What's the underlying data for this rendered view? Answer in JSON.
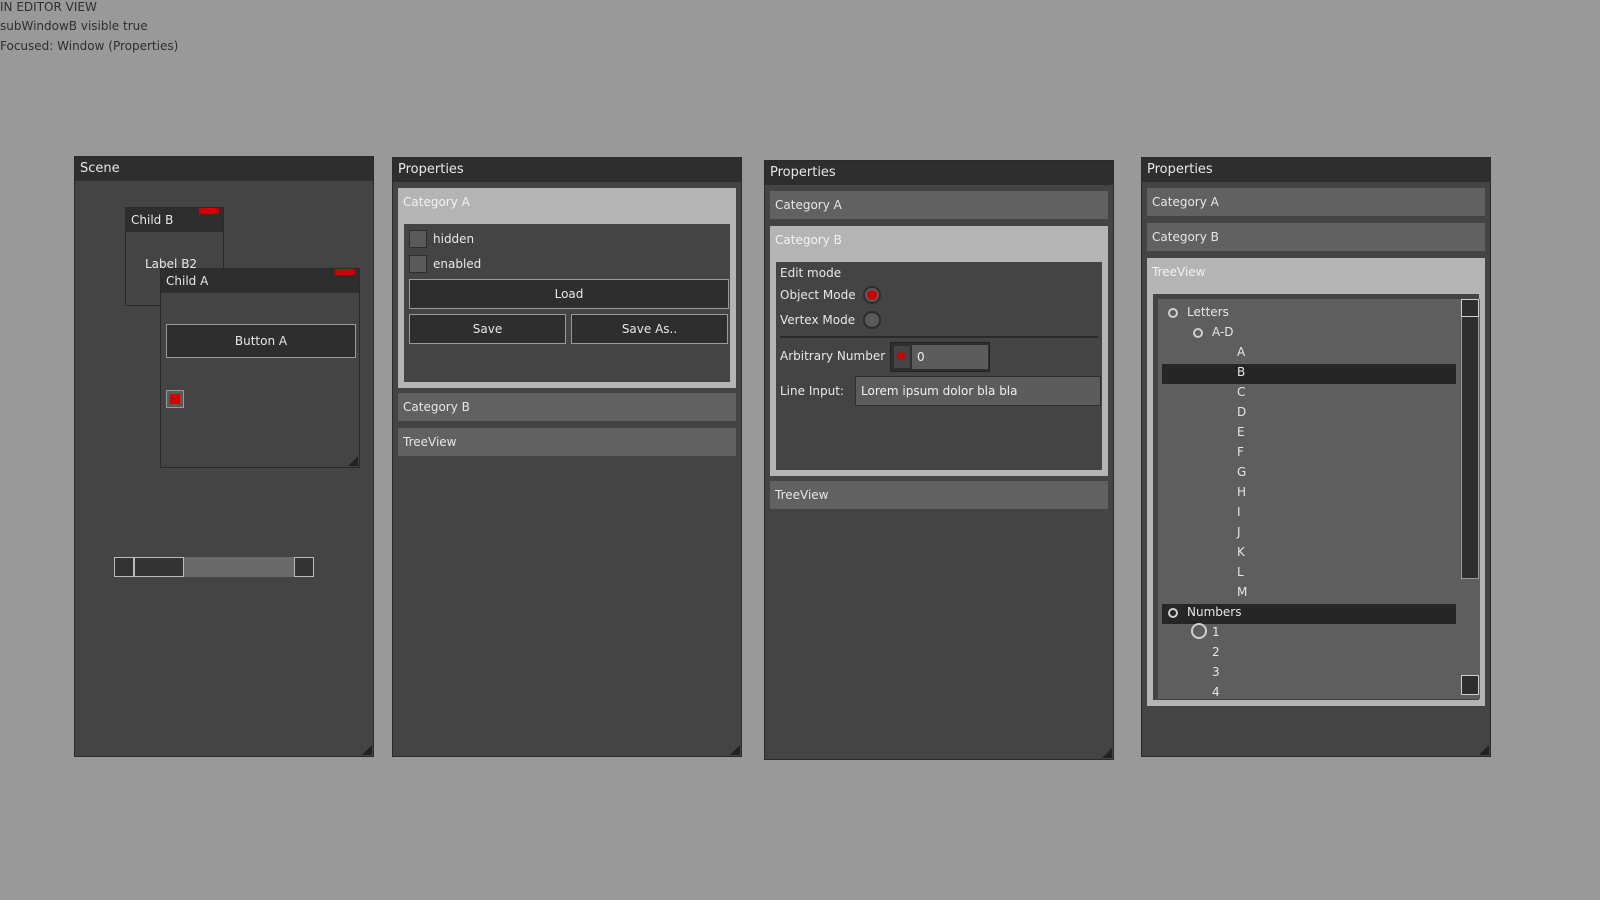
{
  "status": {
    "line1": "IN EDITOR VIEW",
    "line2": "subWindowB visible true",
    "line3": "Focused: Window (Properties)"
  },
  "scene": {
    "title": "Scene",
    "child_b": {
      "title": "Child B",
      "label": "Label B2"
    },
    "child_a": {
      "title": "Child A",
      "button": "Button A"
    },
    "scrollbar": {
      "value": 0.25
    }
  },
  "props1": {
    "title": "Properties",
    "category_a": "Category A",
    "hidden": "hidden",
    "enabled": "enabled",
    "load": "Load",
    "save": "Save",
    "save_as": "Save As..",
    "category_b": "Category B",
    "treeview": "TreeView"
  },
  "props2": {
    "title": "Properties",
    "category_a": "Category A",
    "category_b": "Category B",
    "edit_mode": "Edit mode",
    "object_mode": "Object Mode",
    "vertex_mode": "Vertex Mode",
    "arbitrary_number": "Arbitrary Number",
    "number_value": "0",
    "line_input": "Line Input:",
    "line_value": "Lorem ipsum dolor bla bla",
    "treeview": "TreeView"
  },
  "props3": {
    "title": "Properties",
    "category_a": "Category A",
    "category_b": "Category B",
    "treeview": "TreeView",
    "tree": {
      "letters": "Letters",
      "ad": "A-D",
      "items": [
        "A",
        "B",
        "C",
        "D",
        "E",
        "F",
        "G",
        "H",
        "I",
        "J",
        "K",
        "L",
        "M"
      ],
      "selected_letter": "B",
      "numbers": "Numbers",
      "numbers_items": [
        "1",
        "2",
        "3",
        "4"
      ]
    }
  },
  "colors": {
    "accent": "#cc0000",
    "background": "#999999",
    "panel": "#444444"
  }
}
